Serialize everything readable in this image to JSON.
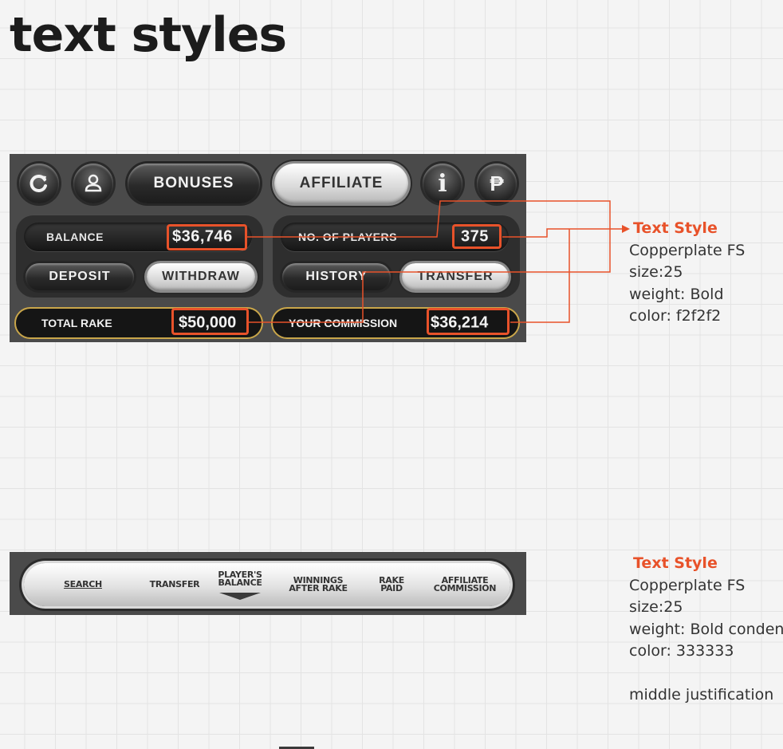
{
  "page": {
    "title": "text styles"
  },
  "panel": {
    "nav": {
      "bonuses_label": "BONUSES",
      "affiliate_label": "AFFILIATE",
      "info_glyph": "i",
      "pp_glyph": "₱",
      "icons": [
        "refresh-icon",
        "user-icon",
        "info-icon",
        "pp-logo-icon"
      ]
    },
    "balance": {
      "label": "BALANCE",
      "value": "$36,746"
    },
    "players": {
      "label": "NO. OF PLAYERS",
      "value": "375"
    },
    "buttons": {
      "deposit": "DEPOSIT",
      "withdraw": "WITHDRAW",
      "history": "HISTORY",
      "transfer": "TRANSFER"
    },
    "rake": {
      "label": "TOTAL RAKE",
      "value": "$50,000"
    },
    "commission": {
      "label": "YOUR COMMISSION",
      "value": "$36,214"
    }
  },
  "annotation1": {
    "heading": "Text Style",
    "font": "Copperplate FS",
    "size": "size:25",
    "weight": "weight: Bold",
    "color": "color: f2f2f2"
  },
  "tabs": [
    {
      "label": "SEARCH"
    },
    {
      "label": "TRANSFER"
    },
    {
      "line1": "PLAYER'S",
      "line2": "BALANCE"
    },
    {
      "line1": "WINNINGS",
      "line2": "AFTER RAKE"
    },
    {
      "line1": "RAKE",
      "line2": "PAID"
    },
    {
      "line1": "AFFILIATE",
      "line2": "COMMISSION"
    }
  ],
  "annotation2": {
    "heading": "Text Style",
    "font": "Copperplate FS",
    "size": "size:25",
    "weight": "weight: Bold condensed",
    "color": "color: 333333",
    "justification": "middle justification"
  },
  "colors": {
    "accent": "#e8522a",
    "panel_text": "#f2f2f2",
    "tab_text": "#333333",
    "gold_border": "#c9a64a"
  }
}
